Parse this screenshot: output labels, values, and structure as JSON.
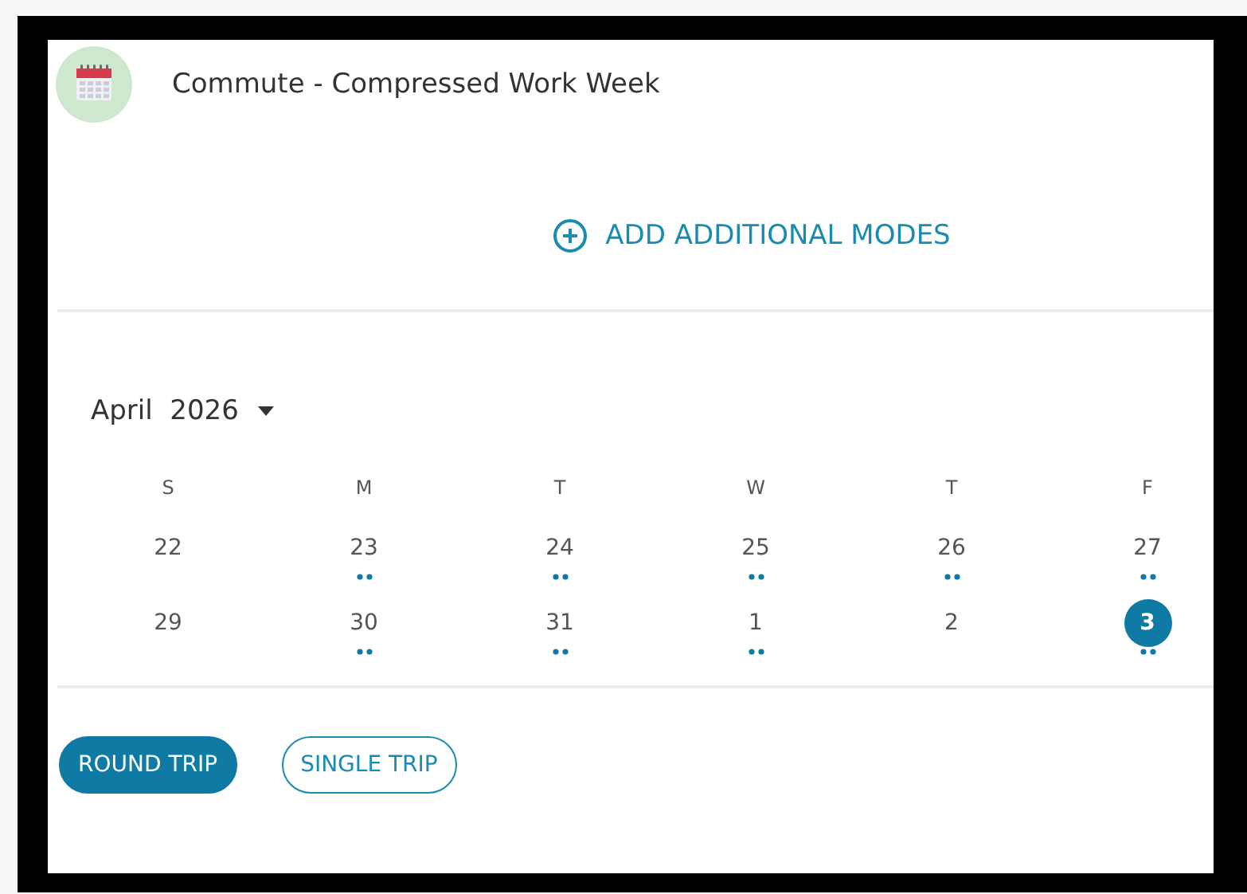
{
  "header": {
    "title": "Commute - Compressed Work Week"
  },
  "add_modes": {
    "label": "ADD ADDITIONAL MODES"
  },
  "calendar": {
    "month": "April",
    "year": "2026",
    "weekdays": [
      "S",
      "M",
      "T",
      "W",
      "T",
      "F"
    ],
    "weeks": [
      {
        "days": [
          {
            "label": "22",
            "dots": false,
            "selected": false
          },
          {
            "label": "23",
            "dots": true,
            "selected": false
          },
          {
            "label": "24",
            "dots": true,
            "selected": false
          },
          {
            "label": "25",
            "dots": true,
            "selected": false
          },
          {
            "label": "26",
            "dots": true,
            "selected": false
          },
          {
            "label": "27",
            "dots": true,
            "selected": false
          }
        ]
      },
      {
        "days": [
          {
            "label": "29",
            "dots": false,
            "selected": false
          },
          {
            "label": "30",
            "dots": true,
            "selected": false
          },
          {
            "label": "31",
            "dots": true,
            "selected": false
          },
          {
            "label": "1",
            "dots": true,
            "selected": false
          },
          {
            "label": "2",
            "dots": false,
            "selected": false
          },
          {
            "label": "3",
            "dots": true,
            "selected": true
          }
        ]
      }
    ]
  },
  "trip_types": [
    {
      "label": "ROUND TRIP",
      "selected": true
    },
    {
      "label": "SINGLE TRIP",
      "selected": false
    }
  ]
}
